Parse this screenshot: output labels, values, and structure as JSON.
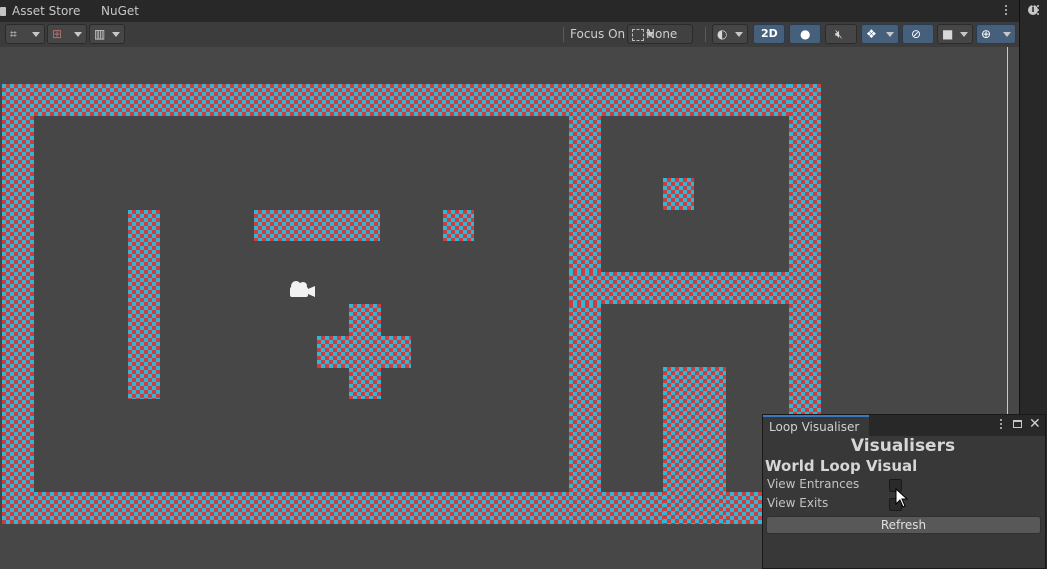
{
  "tabs": {
    "asset_store": "Asset Store",
    "nuget": "NuGet"
  },
  "toolbar": {
    "focus_label": "Focus On",
    "focus_value": "None",
    "mode_2d": "2D"
  },
  "panel": {
    "tab_title": "Loop Visualiser",
    "heading": "Visualisers",
    "subheading": "World Loop Visual",
    "view_entrances_label": "View Entrances",
    "view_exits_label": "View Exits",
    "view_entrances_checked": false,
    "view_exits_checked": false,
    "refresh_label": "Refresh"
  },
  "colors": {
    "brick_red": "#d23b3b",
    "brick_cyan": "#2fb8d6",
    "scene_background": "#474747",
    "active_button": "#46607c"
  }
}
